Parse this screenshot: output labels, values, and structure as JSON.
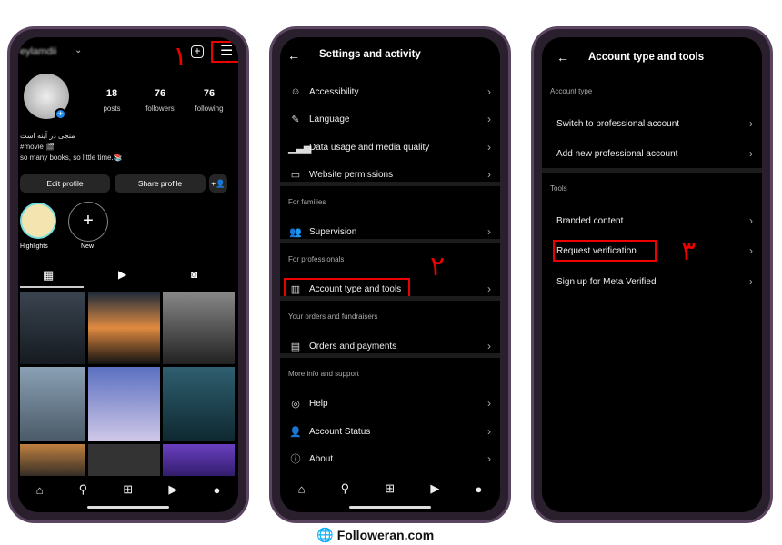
{
  "step_labels": [
    "١",
    "٢",
    "٣"
  ],
  "profile": {
    "username": "eylamdii",
    "stats": [
      {
        "value": "18",
        "label": "posts"
      },
      {
        "value": "76",
        "label": "followers"
      },
      {
        "value": "76",
        "label": "following"
      }
    ],
    "bio": [
      "منجی در آینه است",
      "#movie 🎬",
      "so many books, so little time.📚"
    ],
    "edit_profile": "Edit profile",
    "share_profile": "Share profile",
    "highlights": [
      {
        "label": "Highlights"
      },
      {
        "label": "New"
      }
    ]
  },
  "settings": {
    "title": "Settings and activity",
    "items": [
      {
        "type": "item",
        "icon": "accessibility-icon",
        "glyph": "☺",
        "label": "Accessibility"
      },
      {
        "type": "item",
        "icon": "language-icon",
        "glyph": "✎",
        "label": "Language"
      },
      {
        "type": "item",
        "icon": "signal-icon",
        "glyph": "▁▃▅",
        "label": "Data usage and media quality"
      },
      {
        "type": "item",
        "icon": "laptop-icon",
        "glyph": "▭",
        "label": "Website permissions"
      },
      {
        "type": "section",
        "label": "For families"
      },
      {
        "type": "item",
        "icon": "supervision-icon",
        "glyph": "👥",
        "label": "Supervision"
      },
      {
        "type": "section",
        "label": "For professionals"
      },
      {
        "type": "item",
        "icon": "chart-icon",
        "glyph": "▥",
        "label": "Account type and tools",
        "highlight": true
      },
      {
        "type": "section",
        "label": "Your orders and fundraisers"
      },
      {
        "type": "item",
        "icon": "orders-icon",
        "glyph": "▤",
        "label": "Orders and payments"
      },
      {
        "type": "section",
        "label": "More info and support"
      },
      {
        "type": "item",
        "icon": "help-icon",
        "glyph": "◎",
        "label": "Help"
      },
      {
        "type": "item",
        "icon": "account-status-icon",
        "glyph": "👤",
        "label": "Account Status"
      },
      {
        "type": "item",
        "icon": "info-icon",
        "glyph": "ⓘ",
        "label": "About"
      }
    ]
  },
  "tools": {
    "title": "Account type and tools",
    "items": [
      {
        "type": "section",
        "label": "Account type"
      },
      {
        "type": "item",
        "label": "Switch to professional account"
      },
      {
        "type": "item",
        "label": "Add new professional account"
      },
      {
        "type": "section",
        "label": "Tools"
      },
      {
        "type": "item",
        "label": "Branded content"
      },
      {
        "type": "item",
        "label": "Request verification",
        "highlight": true
      },
      {
        "type": "item",
        "label": "Sign up for Meta Verified"
      }
    ]
  },
  "footer": {
    "brand": "Followeran.com"
  }
}
